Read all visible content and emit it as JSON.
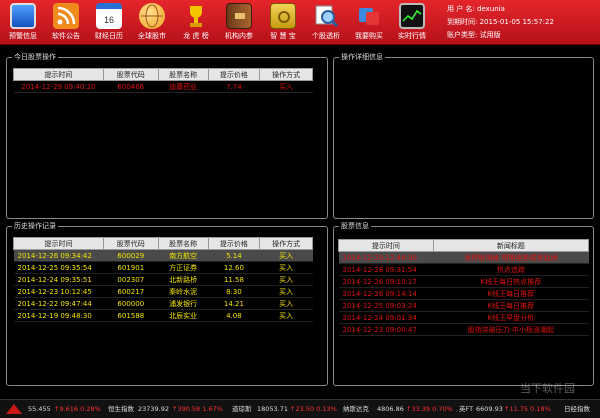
{
  "toolbar": {
    "items": [
      {
        "label": "预警信息",
        "icon": "monitor-icon"
      },
      {
        "label": "软件公告",
        "icon": "rss-icon"
      },
      {
        "label": "财经日历",
        "icon": "calendar-icon"
      },
      {
        "label": "全球股市",
        "icon": "globe-icon"
      },
      {
        "label": "龙 虎 榜",
        "icon": "trophy-icon"
      },
      {
        "label": "机构内参",
        "icon": "book-icon"
      },
      {
        "label": "智 慧 宝",
        "icon": "safe-icon"
      },
      {
        "label": "个股透析",
        "icon": "magnifier-icon"
      },
      {
        "label": "我要购买",
        "icon": "cart-icon"
      },
      {
        "label": "实时行情",
        "icon": "realtime-screen-icon"
      }
    ]
  },
  "account": {
    "user_label": "用 户 名:",
    "user_value": "dexunia",
    "expire_label": "到期时间:",
    "expire_value": "2015-01-05 15:57:22",
    "type_label": "账户类型:",
    "type_value": "试用版"
  },
  "today_ops": {
    "title": "今日股票操作",
    "columns": [
      "提示时间",
      "股票代码",
      "股票名称",
      "提示价格",
      "操作方式"
    ],
    "rows": [
      [
        "2014-12-29 09:40:20",
        "600466",
        "迪康药业",
        "7.74",
        "买入"
      ]
    ]
  },
  "detail": {
    "title": "操作详细信息"
  },
  "history": {
    "title": "历史操作记录",
    "columns": [
      "提示时间",
      "股票代码",
      "股票名称",
      "提示价格",
      "操作方式"
    ],
    "rows": [
      [
        "2014-12-26 09:34:42",
        "600029",
        "南方航空",
        "5.14",
        "买入"
      ],
      [
        "2014-12-25 09:35:54",
        "601901",
        "方正证券",
        "12.60",
        "买入"
      ],
      [
        "2014-12-24 09:35:51",
        "002307",
        "北新路桥",
        "11.58",
        "买入"
      ],
      [
        "2014-12-23 10:12:45",
        "600217",
        "秦岭水泥",
        "8.30",
        "买入"
      ],
      [
        "2014-12-22 09:47:44",
        "600000",
        "浦发银行",
        "14.21",
        "买入"
      ],
      [
        "2014-12-19 09:48:30",
        "601588",
        "北辰实业",
        "4.08",
        "买入"
      ]
    ]
  },
  "stock_info": {
    "title": "股票信息",
    "columns": [
      "提示时间",
      "新闻标题"
    ],
    "rows": [
      [
        "2014-12-29 12:46:30",
        "涨停板揭秘 短期涨势或将延续"
      ],
      [
        "2014-12-28 09:31:54",
        "热点追踪"
      ],
      [
        "2014-12-26 09:10:17",
        "K线王每日热点推荐"
      ],
      [
        "2014-12-26 09:14:14",
        "K线王每日推荐"
      ],
      [
        "2014-12-25 09:03:24",
        "K线王每日推荐"
      ],
      [
        "2014-12-24 09:01:34",
        "K线王早盘分析"
      ],
      [
        "2014-12-23 09:00:47",
        "股指突破压力 中小板涨潮起"
      ]
    ]
  },
  "ticker": [
    {
      "text": "55.455"
    },
    {
      "text": "↑9.616 0.28%",
      "up": true
    },
    {
      "text": "恒生指数",
      "label": true
    },
    {
      "text": "23739.92"
    },
    {
      "text": "↑390.58 1.67%",
      "up": true
    },
    {
      "text": "道琼斯",
      "label": true
    },
    {
      "text": "18053.71"
    },
    {
      "text": "↑23.50 0.13%",
      "up": true
    },
    {
      "text": "纳斯达克",
      "label": true
    },
    {
      "text": "4806.86"
    },
    {
      "text": "↑33.39 0.70%",
      "up": true
    },
    {
      "text": "英FT",
      "label": true
    },
    {
      "text": "6609.93"
    },
    {
      "text": "↑11.75 0.18%",
      "up": true
    },
    {
      "text": "日经指数",
      "label": true
    }
  ],
  "watermark": "当下软件园",
  "colors": {
    "toolbar": "#d41a22",
    "alert": "#e01010",
    "highlight": "#f2e300"
  }
}
